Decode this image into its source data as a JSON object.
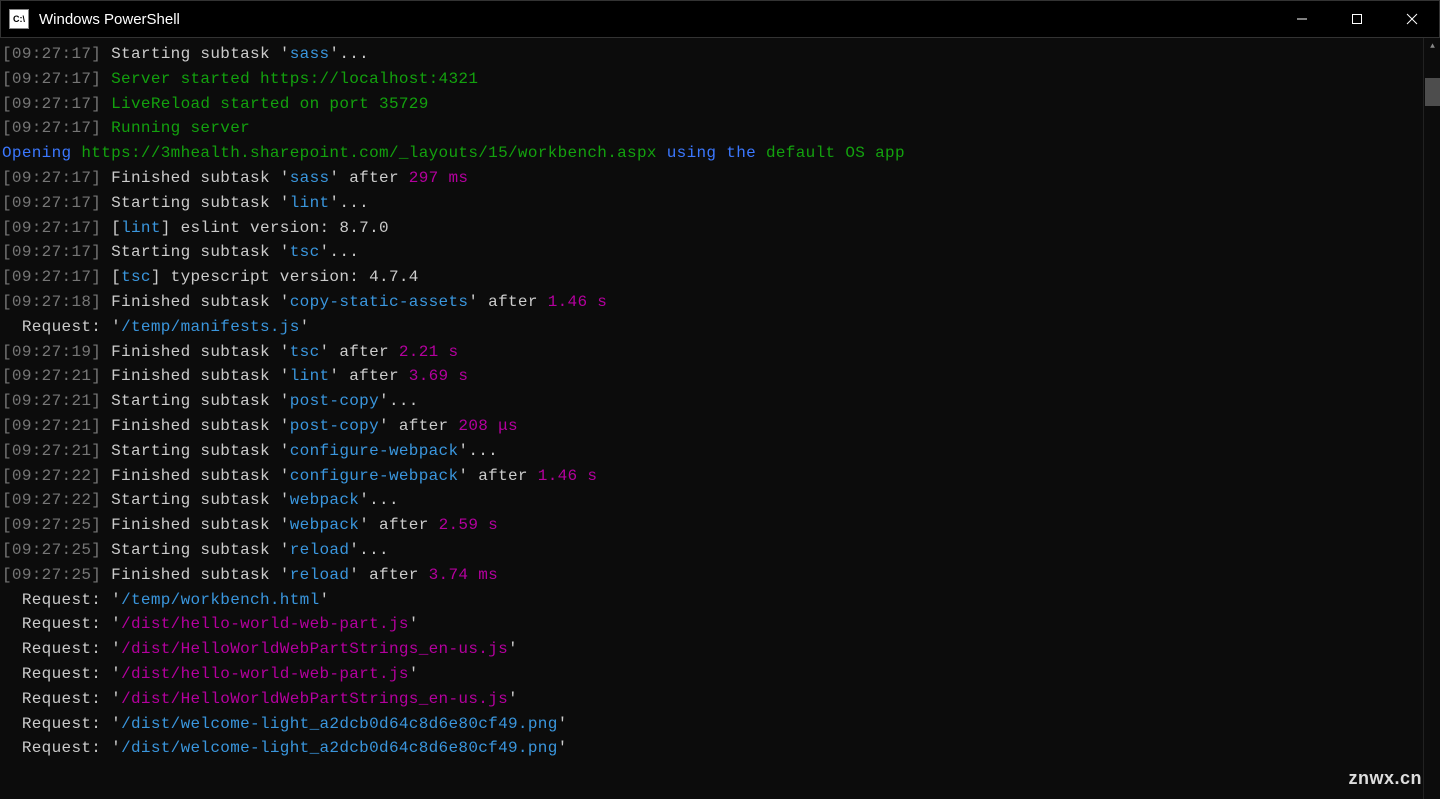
{
  "window": {
    "icon_text": "C:\\",
    "title": "Windows PowerShell"
  },
  "colors": {
    "gray": "#767676",
    "white": "#cccccc",
    "cyan": "#3a96dd",
    "green": "#13a10e",
    "blue": "#3b78ff",
    "magenta": "#b4009e"
  },
  "watermark": "znwx.cn",
  "lines": [
    {
      "segs": [
        {
          "c": "gray",
          "t": "[09:27:17]"
        },
        {
          "c": "white",
          "t": " Starting subtask '"
        },
        {
          "c": "cyan",
          "t": "sass"
        },
        {
          "c": "white",
          "t": "'..."
        }
      ]
    },
    {
      "segs": [
        {
          "c": "gray",
          "t": "[09:27:17]"
        },
        {
          "c": "green",
          "t": " Server started https://localhost:4321"
        }
      ]
    },
    {
      "segs": [
        {
          "c": "gray",
          "t": "[09:27:17]"
        },
        {
          "c": "green",
          "t": " LiveReload started on port 35729"
        }
      ]
    },
    {
      "segs": [
        {
          "c": "gray",
          "t": "[09:27:17]"
        },
        {
          "c": "green",
          "t": " Running server"
        }
      ]
    },
    {
      "segs": [
        {
          "c": "blue",
          "t": "Opening"
        },
        {
          "c": "green",
          "t": " https://3mhealth.sharepoint.com/_layouts/15/workbench.aspx "
        },
        {
          "c": "blue",
          "t": "using the "
        },
        {
          "c": "green",
          "t": "default OS app"
        }
      ]
    },
    {
      "segs": [
        {
          "c": "gray",
          "t": "[09:27:17]"
        },
        {
          "c": "white",
          "t": " Finished subtask '"
        },
        {
          "c": "cyan",
          "t": "sass"
        },
        {
          "c": "white",
          "t": "' after "
        },
        {
          "c": "mag",
          "t": "297 ms"
        }
      ]
    },
    {
      "segs": [
        {
          "c": "gray",
          "t": "[09:27:17]"
        },
        {
          "c": "white",
          "t": " Starting subtask '"
        },
        {
          "c": "cyan",
          "t": "lint"
        },
        {
          "c": "white",
          "t": "'..."
        }
      ]
    },
    {
      "segs": [
        {
          "c": "gray",
          "t": "[09:27:17]"
        },
        {
          "c": "white",
          "t": " ["
        },
        {
          "c": "cyan",
          "t": "lint"
        },
        {
          "c": "white",
          "t": "] eslint version: 8.7.0"
        }
      ]
    },
    {
      "segs": [
        {
          "c": "gray",
          "t": "[09:27:17]"
        },
        {
          "c": "white",
          "t": " Starting subtask '"
        },
        {
          "c": "cyan",
          "t": "tsc"
        },
        {
          "c": "white",
          "t": "'..."
        }
      ]
    },
    {
      "segs": [
        {
          "c": "gray",
          "t": "[09:27:17]"
        },
        {
          "c": "white",
          "t": " ["
        },
        {
          "c": "cyan",
          "t": "tsc"
        },
        {
          "c": "white",
          "t": "] typescript version: 4.7.4"
        }
      ]
    },
    {
      "segs": [
        {
          "c": "gray",
          "t": "[09:27:18]"
        },
        {
          "c": "white",
          "t": " Finished subtask '"
        },
        {
          "c": "cyan",
          "t": "copy-static-assets"
        },
        {
          "c": "white",
          "t": "' after "
        },
        {
          "c": "mag",
          "t": "1.46 s"
        }
      ]
    },
    {
      "segs": [
        {
          "c": "white",
          "t": "  Request: '"
        },
        {
          "c": "cyan",
          "t": "/temp/manifests.js"
        },
        {
          "c": "white",
          "t": "'"
        }
      ]
    },
    {
      "segs": [
        {
          "c": "gray",
          "t": "[09:27:19]"
        },
        {
          "c": "white",
          "t": " Finished subtask '"
        },
        {
          "c": "cyan",
          "t": "tsc"
        },
        {
          "c": "white",
          "t": "' after "
        },
        {
          "c": "mag",
          "t": "2.21 s"
        }
      ]
    },
    {
      "segs": [
        {
          "c": "gray",
          "t": "[09:27:21]"
        },
        {
          "c": "white",
          "t": " Finished subtask '"
        },
        {
          "c": "cyan",
          "t": "lint"
        },
        {
          "c": "white",
          "t": "' after "
        },
        {
          "c": "mag",
          "t": "3.69 s"
        }
      ]
    },
    {
      "segs": [
        {
          "c": "gray",
          "t": "[09:27:21]"
        },
        {
          "c": "white",
          "t": " Starting subtask '"
        },
        {
          "c": "cyan",
          "t": "post-copy"
        },
        {
          "c": "white",
          "t": "'..."
        }
      ]
    },
    {
      "segs": [
        {
          "c": "gray",
          "t": "[09:27:21]"
        },
        {
          "c": "white",
          "t": " Finished subtask '"
        },
        {
          "c": "cyan",
          "t": "post-copy"
        },
        {
          "c": "white",
          "t": "' after "
        },
        {
          "c": "mag",
          "t": "208 μs"
        }
      ]
    },
    {
      "segs": [
        {
          "c": "gray",
          "t": "[09:27:21]"
        },
        {
          "c": "white",
          "t": " Starting subtask '"
        },
        {
          "c": "cyan",
          "t": "configure-webpack"
        },
        {
          "c": "white",
          "t": "'..."
        }
      ]
    },
    {
      "segs": [
        {
          "c": "gray",
          "t": "[09:27:22]"
        },
        {
          "c": "white",
          "t": " Finished subtask '"
        },
        {
          "c": "cyan",
          "t": "configure-webpack"
        },
        {
          "c": "white",
          "t": "' after "
        },
        {
          "c": "mag",
          "t": "1.46 s"
        }
      ]
    },
    {
      "segs": [
        {
          "c": "gray",
          "t": "[09:27:22]"
        },
        {
          "c": "white",
          "t": " Starting subtask '"
        },
        {
          "c": "cyan",
          "t": "webpack"
        },
        {
          "c": "white",
          "t": "'..."
        }
      ]
    },
    {
      "segs": [
        {
          "c": "gray",
          "t": "[09:27:25]"
        },
        {
          "c": "white",
          "t": " Finished subtask '"
        },
        {
          "c": "cyan",
          "t": "webpack"
        },
        {
          "c": "white",
          "t": "' after "
        },
        {
          "c": "mag",
          "t": "2.59 s"
        }
      ]
    },
    {
      "segs": [
        {
          "c": "gray",
          "t": "[09:27:25]"
        },
        {
          "c": "white",
          "t": " Starting subtask '"
        },
        {
          "c": "cyan",
          "t": "reload"
        },
        {
          "c": "white",
          "t": "'..."
        }
      ]
    },
    {
      "segs": [
        {
          "c": "gray",
          "t": "[09:27:25]"
        },
        {
          "c": "white",
          "t": " Finished subtask '"
        },
        {
          "c": "cyan",
          "t": "reload"
        },
        {
          "c": "white",
          "t": "' after "
        },
        {
          "c": "mag",
          "t": "3.74 ms"
        }
      ]
    },
    {
      "segs": [
        {
          "c": "white",
          "t": "  Request: '"
        },
        {
          "c": "cyan",
          "t": "/temp/workbench.html"
        },
        {
          "c": "white",
          "t": "'"
        }
      ]
    },
    {
      "segs": [
        {
          "c": "white",
          "t": "  Request: '"
        },
        {
          "c": "mag",
          "t": "/dist/hello-world-web-part.js"
        },
        {
          "c": "white",
          "t": "'"
        }
      ]
    },
    {
      "segs": [
        {
          "c": "white",
          "t": "  Request: '"
        },
        {
          "c": "mag",
          "t": "/dist/HelloWorldWebPartStrings_en-us.js"
        },
        {
          "c": "white",
          "t": "'"
        }
      ]
    },
    {
      "segs": [
        {
          "c": "white",
          "t": "  Request: '"
        },
        {
          "c": "mag",
          "t": "/dist/hello-world-web-part.js"
        },
        {
          "c": "white",
          "t": "'"
        }
      ]
    },
    {
      "segs": [
        {
          "c": "white",
          "t": "  Request: '"
        },
        {
          "c": "mag",
          "t": "/dist/HelloWorldWebPartStrings_en-us.js"
        },
        {
          "c": "white",
          "t": "'"
        }
      ]
    },
    {
      "segs": [
        {
          "c": "white",
          "t": "  Request: '"
        },
        {
          "c": "cyan",
          "t": "/dist/welcome-light_a2dcb0d64c8d6e80cf49.png"
        },
        {
          "c": "white",
          "t": "'"
        }
      ]
    },
    {
      "segs": [
        {
          "c": "white",
          "t": "  Request: '"
        },
        {
          "c": "cyan",
          "t": "/dist/welcome-light_a2dcb0d64c8d6e80cf49.png"
        },
        {
          "c": "white",
          "t": "'"
        }
      ]
    }
  ]
}
